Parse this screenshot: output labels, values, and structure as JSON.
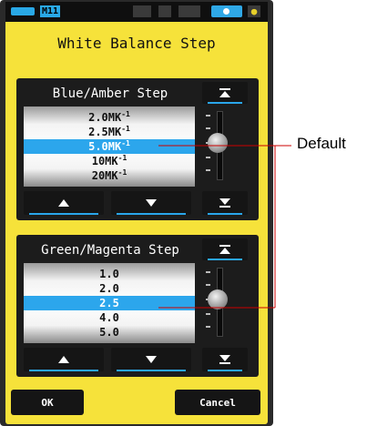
{
  "status_bar": {
    "memory_label": "M11",
    "battery_icon": "battery-icon",
    "lock_icon": "lock-icon"
  },
  "title": "White Balance Step",
  "blue_amber": {
    "title": "Blue/Amber Step",
    "items": [
      {
        "value": "2.0MK",
        "sup": "-1"
      },
      {
        "value": "2.5MK",
        "sup": "-1"
      },
      {
        "value": "5.0MK",
        "sup": "-1"
      },
      {
        "value": "10MK",
        "sup": "-1"
      },
      {
        "value": "20MK",
        "sup": "-1"
      }
    ],
    "selected_index": 2
  },
  "green_magenta": {
    "title": "Green/Magenta Step",
    "items": [
      "1.0",
      "2.0",
      "2.5",
      "4.0",
      "5.0"
    ],
    "selected_index": 2
  },
  "buttons": {
    "ok": "OK",
    "cancel": "Cancel"
  },
  "annotation": {
    "label": "Default"
  },
  "colors": {
    "screen": "#f6e23a",
    "accent": "#2ca6ec",
    "annotation_line": "#cc0000"
  }
}
